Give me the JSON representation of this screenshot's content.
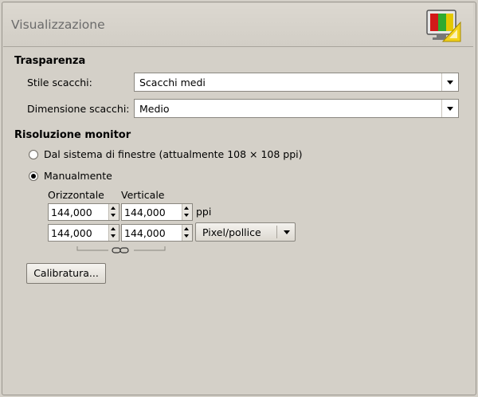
{
  "header": {
    "title": "Visualizzazione",
    "icon": "display-settings-icon"
  },
  "transparency": {
    "section_title": "Trasparenza",
    "check_style_label": "Stile scacchi:",
    "check_style_value": "Scacchi medi",
    "check_size_label": "Dimensione scacchi:",
    "check_size_value": "Medio"
  },
  "resolution": {
    "section_title": "Risoluzione monitor",
    "from_system_label": "Dal sistema di finestre (attualmente 108 × 108 ppi)",
    "from_system_selected": false,
    "manual_label": "Manualmente",
    "manual_selected": true,
    "horizontal_header": "Orizzontale",
    "vertical_header": "Verticale",
    "row1_horizontal": "144,000",
    "row1_vertical": "144,000",
    "row1_unit": "ppi",
    "row2_horizontal": "144,000",
    "row2_vertical": "144,000",
    "unit_select": "Pixel/pollice",
    "calibrate_button": "Calibratura..."
  }
}
